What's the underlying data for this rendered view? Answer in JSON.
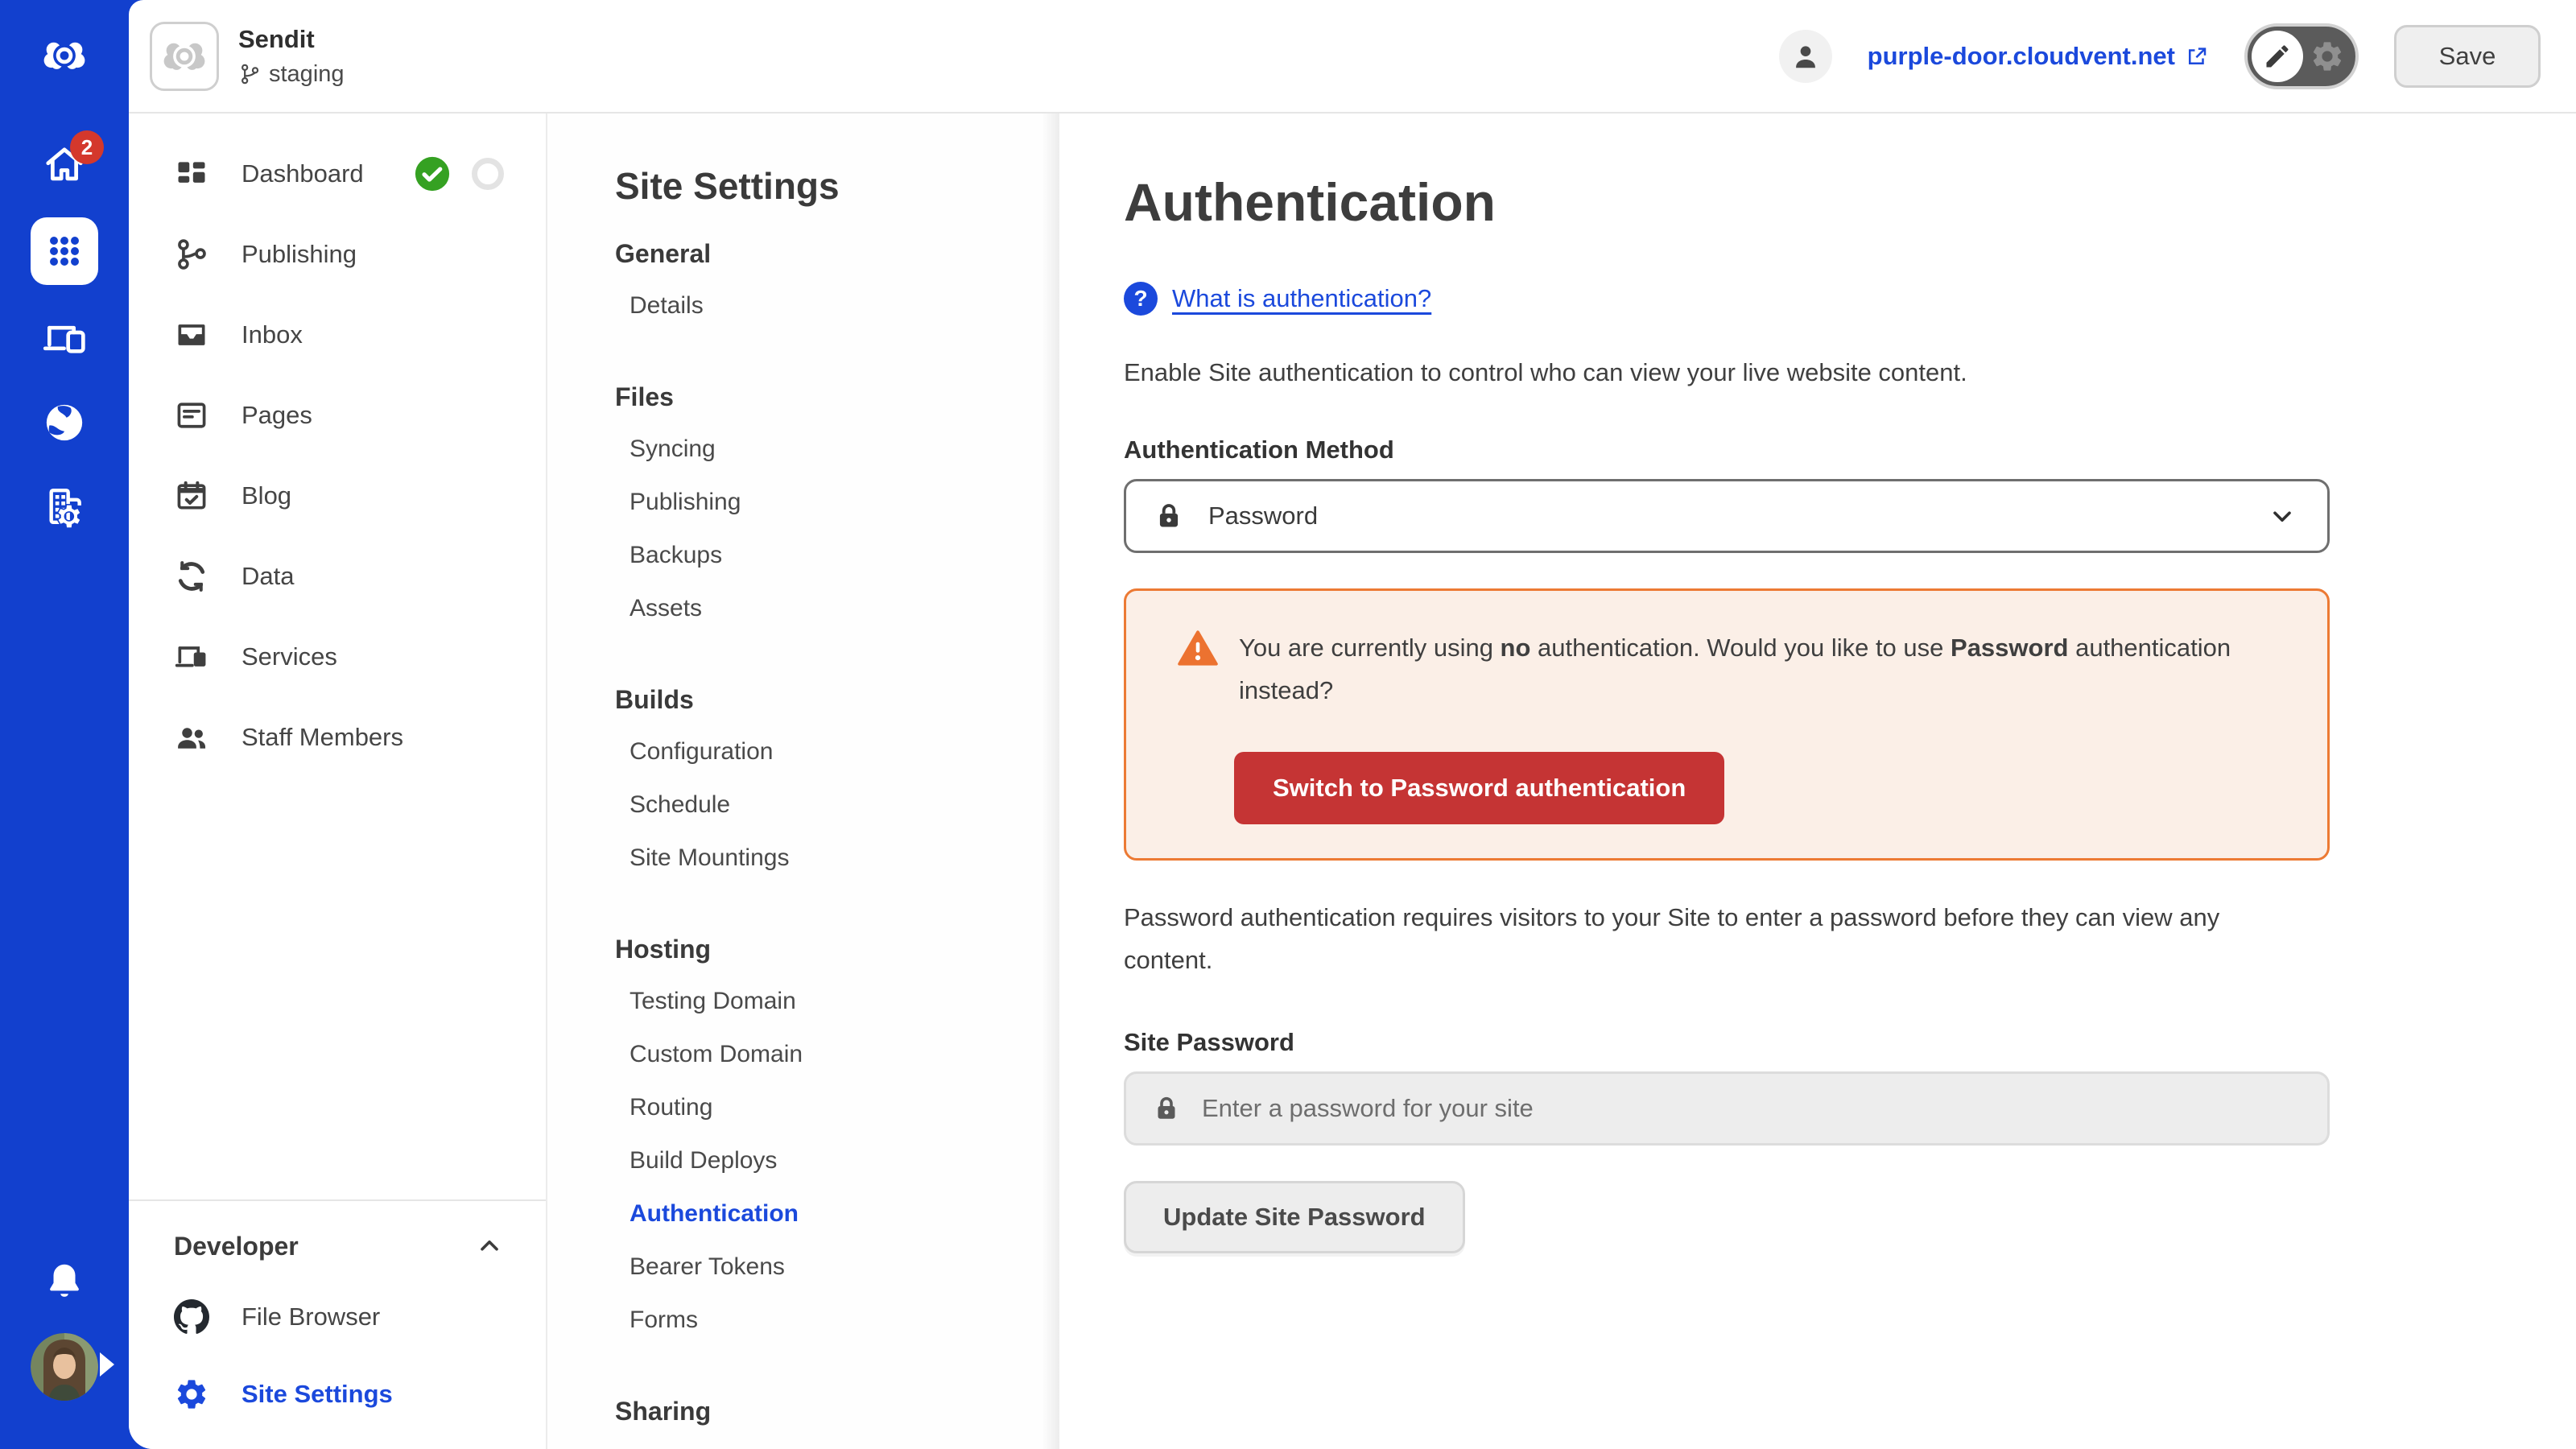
{
  "topbar": {
    "site_name": "Sendit",
    "branch": "staging",
    "live_url": "purple-door.cloudvent.net",
    "save_label": "Save"
  },
  "rail": {
    "home_badge": "2",
    "icons": [
      "cloudcannon-logo",
      "home",
      "apps-grid",
      "devices",
      "globe",
      "organization",
      "bell",
      "avatar"
    ]
  },
  "sidebar": {
    "items": [
      {
        "label": "Dashboard",
        "icon": "dashboard-tiles"
      },
      {
        "label": "Publishing",
        "icon": "git-branch"
      },
      {
        "label": "Inbox",
        "icon": "inbox-tray"
      },
      {
        "label": "Pages",
        "icon": "document"
      },
      {
        "label": "Blog",
        "icon": "calendar-check"
      },
      {
        "label": "Data",
        "icon": "sync-arrows"
      },
      {
        "label": "Services",
        "icon": "devices"
      },
      {
        "label": "Staff Members",
        "icon": "people"
      }
    ],
    "dashboard_status": {
      "built": "success",
      "pending": "empty"
    },
    "developer": {
      "heading": "Developer",
      "items": [
        {
          "label": "File Browser",
          "icon": "github"
        },
        {
          "label": "Site Settings",
          "icon": "gear",
          "active": true
        }
      ]
    }
  },
  "settings_nav": {
    "title": "Site Settings",
    "active_item": "Authentication",
    "sections": [
      {
        "heading": "General",
        "items": [
          "Details"
        ]
      },
      {
        "heading": "Files",
        "items": [
          "Syncing",
          "Publishing",
          "Backups",
          "Assets"
        ]
      },
      {
        "heading": "Builds",
        "items": [
          "Configuration",
          "Schedule",
          "Site Mountings"
        ]
      },
      {
        "heading": "Hosting",
        "items": [
          "Testing Domain",
          "Custom Domain",
          "Routing",
          "Build Deploys",
          "Authentication",
          "Bearer Tokens",
          "Forms"
        ]
      },
      {
        "heading": "Sharing",
        "items": []
      }
    ]
  },
  "main": {
    "title": "Authentication",
    "help_link": "What is authentication?",
    "intro": "Enable Site authentication to control who can view your live website content.",
    "method": {
      "label": "Authentication Method",
      "value": "Password"
    },
    "warning": {
      "part1": "You are currently using ",
      "bold1": "no",
      "part2": " authentication. Would you like to use ",
      "bold2": "Password",
      "part3": " authentication instead?",
      "button": "Switch to Password authentication"
    },
    "password_info": "Password authentication requires visitors to your Site to enter a password before they can view any content.",
    "site_password": {
      "label": "Site Password",
      "placeholder": "Enter a password for your site",
      "button": "Update Site Password"
    }
  },
  "colors": {
    "rail_blue": "#1240CE",
    "accent_blue": "#1B49DC",
    "success_green": "#35A122",
    "badge_red": "#D4382C",
    "danger_red": "#C53434",
    "warning_border": "#EC7A34",
    "warning_bg": "#FBEFE7"
  }
}
